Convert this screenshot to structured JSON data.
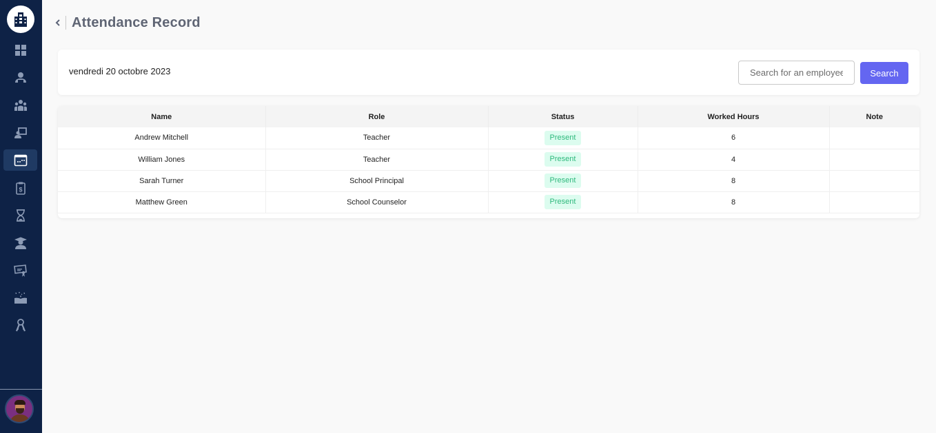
{
  "header": {
    "title": "Attendance Record",
    "back_icon": "chevron-left-icon"
  },
  "sidebar": {
    "logo_icon": "school-building-icon",
    "items": [
      {
        "name": "dashboard",
        "icon": "grid-icon",
        "active": false
      },
      {
        "name": "students",
        "icon": "reading-student-icon",
        "active": false
      },
      {
        "name": "staff",
        "icon": "group-icon",
        "active": false
      },
      {
        "name": "classes",
        "icon": "teacher-board-icon",
        "active": false
      },
      {
        "name": "attendance",
        "icon": "calendar-window-icon",
        "active": true
      },
      {
        "name": "payments",
        "icon": "clipboard-dollar-icon",
        "active": false
      },
      {
        "name": "schedule",
        "icon": "hourglass-icon",
        "active": false
      },
      {
        "name": "graduates",
        "icon": "graduate-icon",
        "active": false
      },
      {
        "name": "certificates",
        "icon": "certificate-icon",
        "active": false
      },
      {
        "name": "library",
        "icon": "open-book-icon",
        "active": false
      },
      {
        "name": "keys",
        "icon": "keys-icon",
        "active": false
      }
    ]
  },
  "toolbar": {
    "date": "vendredi 20 octobre 2023",
    "search_placeholder": "Search for an employee",
    "search_label": "Search"
  },
  "table": {
    "columns": [
      "Name",
      "Role",
      "Status",
      "Worked Hours",
      "Note"
    ],
    "rows": [
      {
        "name": "Andrew Mitchell",
        "role": "Teacher",
        "status": "Present",
        "hours": "6",
        "note": ""
      },
      {
        "name": "William Jones",
        "role": "Teacher",
        "status": "Present",
        "hours": "4",
        "note": ""
      },
      {
        "name": "Sarah Turner",
        "role": "School Principal",
        "status": "Present",
        "hours": "8",
        "note": ""
      },
      {
        "name": "Matthew Green",
        "role": "School Counselor",
        "status": "Present",
        "hours": "8",
        "note": ""
      }
    ]
  },
  "colors": {
    "sidebar_bg": "#0e2246",
    "accent": "#6466f1",
    "present_bg": "#dcfcef",
    "present_text": "#2fb97d"
  }
}
